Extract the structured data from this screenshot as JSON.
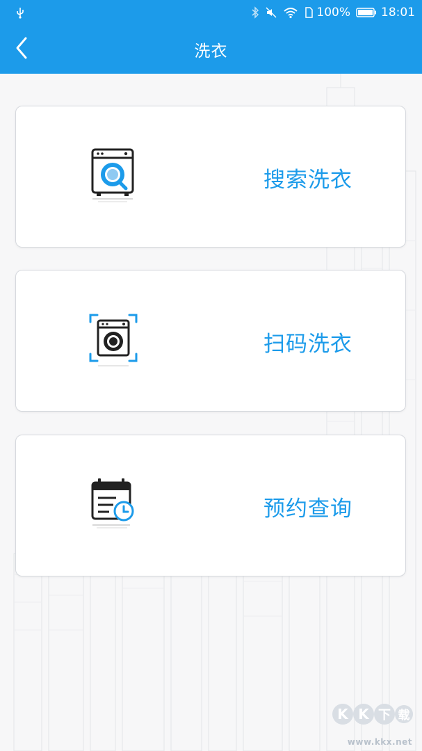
{
  "status_bar": {
    "battery": "100%",
    "time": "18:01",
    "icons": [
      "usb-icon",
      "bluetooth-icon",
      "mute-icon",
      "wifi-icon",
      "sim-icon",
      "battery-icon"
    ]
  },
  "header": {
    "title": "洗衣",
    "back_icon": "chevron-left-icon"
  },
  "menu": [
    {
      "label": "搜索洗衣",
      "icon": "washer-search-icon"
    },
    {
      "label": "扫码洗衣",
      "icon": "washer-scan-icon"
    },
    {
      "label": "预约查询",
      "icon": "calendar-clock-icon"
    }
  ],
  "watermark": {
    "logo_text": "KK下载",
    "url": "www.kkx.net"
  },
  "colors": {
    "primary": "#1c9bea",
    "card_border": "#d6d9de",
    "background": "#f7f7f8"
  }
}
